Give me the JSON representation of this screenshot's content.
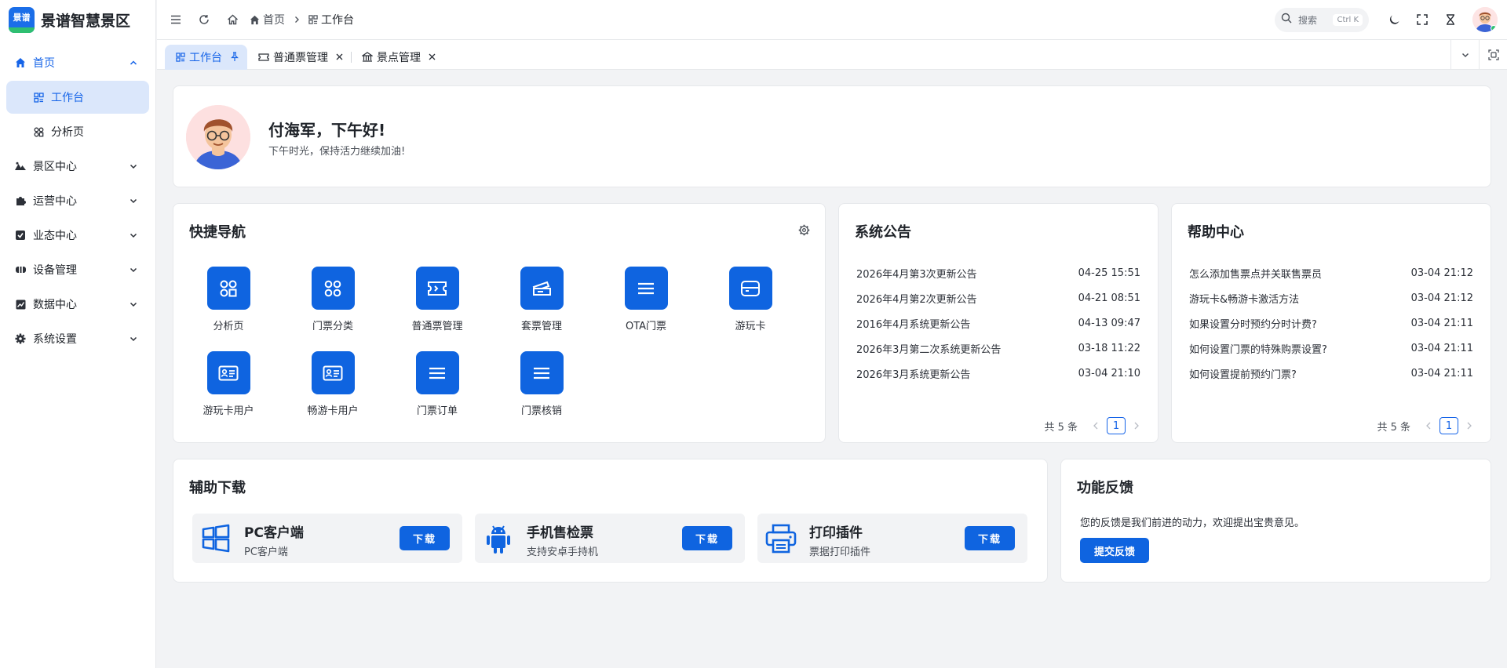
{
  "brand": {
    "logo_text": "景谱",
    "name": "景谱智慧景区"
  },
  "sidebar": {
    "items": [
      {
        "label": "首页",
        "icon": "home-icon",
        "expanded": true
      },
      {
        "label": "工作台",
        "icon": "dashboard-icon",
        "active": true
      },
      {
        "label": "分析页",
        "icon": "apps-icon"
      },
      {
        "label": "景区中心",
        "icon": "landscape-icon"
      },
      {
        "label": "运营中心",
        "icon": "puzzle-icon"
      },
      {
        "label": "业态中心",
        "icon": "shop-icon"
      },
      {
        "label": "设备管理",
        "icon": "device-icon"
      },
      {
        "label": "数据中心",
        "icon": "chart-icon"
      },
      {
        "label": "系统设置",
        "icon": "gear-icon"
      }
    ]
  },
  "header": {
    "breadcrumb": {
      "home": "首页",
      "current": "工作台"
    },
    "search": {
      "placeholder": "搜索",
      "shortcut": "Ctrl K"
    }
  },
  "tabs": [
    {
      "label": "工作台",
      "active": true
    },
    {
      "label": "普通票管理"
    },
    {
      "label": "景点管理"
    }
  ],
  "welcome": {
    "greeting": "付海军，下午好!",
    "subtitle": "下午时光，保持活力继续加油!"
  },
  "quick_nav": {
    "title": "快捷导航",
    "items": [
      {
        "label": "分析页",
        "icon": "apps-icon"
      },
      {
        "label": "门票分类",
        "icon": "grid-dots-icon"
      },
      {
        "label": "普通票管理",
        "icon": "ticket-icon"
      },
      {
        "label": "套票管理",
        "icon": "tickets-icon"
      },
      {
        "label": "OTA门票",
        "icon": "menu-icon"
      },
      {
        "label": "游玩卡",
        "icon": "card-icon"
      },
      {
        "label": "游玩卡用户",
        "icon": "id-card-icon"
      },
      {
        "label": "畅游卡用户",
        "icon": "id-card-icon"
      },
      {
        "label": "门票订单",
        "icon": "menu-icon"
      },
      {
        "label": "门票核销",
        "icon": "menu-icon"
      }
    ]
  },
  "notices": {
    "title": "系统公告",
    "rows": [
      {
        "title": "2026年4月第3次更新公告",
        "date": "04-25 15:51"
      },
      {
        "title": "2026年4月第2次更新公告",
        "date": "04-21 08:51"
      },
      {
        "title": "2016年4月系统更新公告",
        "date": "04-13 09:47"
      },
      {
        "title": "2026年3月第二次系统更新公告",
        "date": "03-18 11:22"
      },
      {
        "title": "2026年3月系统更新公告",
        "date": "03-04 21:10"
      }
    ],
    "total": "共 5 条",
    "page": "1"
  },
  "help": {
    "title": "帮助中心",
    "rows": [
      {
        "title": "怎么添加售票点并关联售票员",
        "date": "03-04 21:12"
      },
      {
        "title": "游玩卡&畅游卡激活方法",
        "date": "03-04 21:12"
      },
      {
        "title": "如果设置分时预约分时计费?",
        "date": "03-04 21:11"
      },
      {
        "title": "如何设置门票的特殊购票设置?",
        "date": "03-04 21:11"
      },
      {
        "title": "如何设置提前预约门票?",
        "date": "03-04 21:11"
      }
    ],
    "total": "共 5 条",
    "page": "1"
  },
  "downloads": {
    "title": "辅助下载",
    "items": [
      {
        "name": "PC客户端",
        "desc": "PC客户端",
        "button": "下载",
        "icon": "windows-icon"
      },
      {
        "name": "手机售检票",
        "desc": "支持安卓手持机",
        "button": "下载",
        "icon": "android-icon"
      },
      {
        "name": "打印插件",
        "desc": "票据打印插件",
        "button": "下载",
        "icon": "printer-icon"
      }
    ]
  },
  "feedback": {
    "title": "功能反馈",
    "text": "您的反馈是我们前进的动力，欢迎提出宝贵意见。",
    "button": "提交反馈"
  },
  "colors": {
    "primary": "#0f64e0",
    "accent": "#1664e8",
    "active_bg": "#dbe7fb",
    "bg": "#f2f3f5"
  }
}
